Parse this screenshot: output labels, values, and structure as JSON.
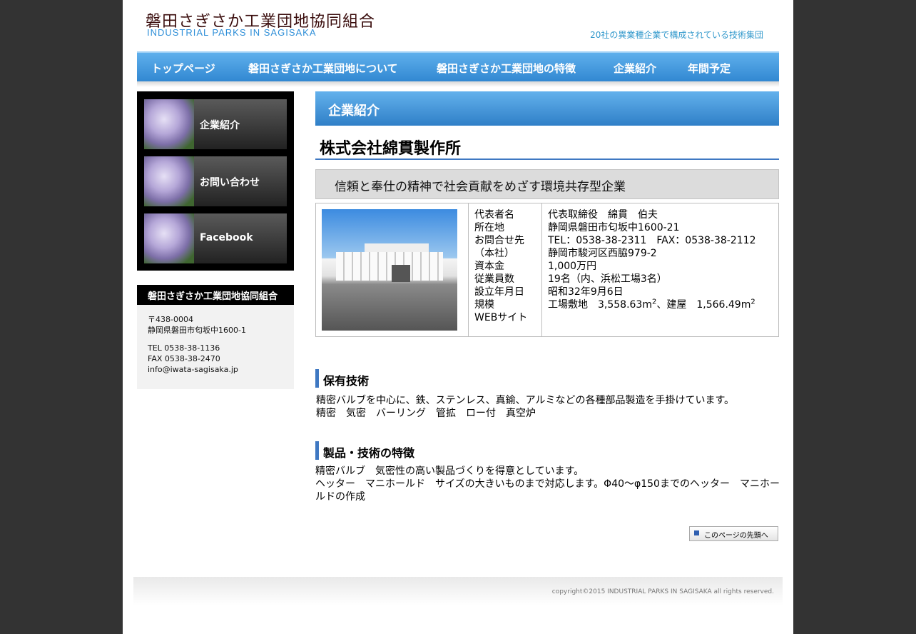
{
  "header": {
    "logo_jp": "磐田さぎさか工業団地協同組合",
    "logo_en": "INDUSTRIAL PARKS IN SAGISAKA",
    "tagline": "20社の異業種企業で構成されている技術集団"
  },
  "nav": {
    "items": [
      "トップページ",
      "磐田さぎさか工業団地について",
      "磐田さぎさか工業団地の特徴",
      "企業紹介",
      "年間予定"
    ]
  },
  "sidebar": {
    "buttons": [
      "企業紹介",
      "お問い合わせ",
      "Facebook"
    ],
    "org_title": "磐田さぎさか工業団地協同組合",
    "postal": "〒438-0004",
    "address": "静岡県磐田市匂坂中1600-1",
    "tel": "TEL 0538-38-1136",
    "fax": "FAX 0538-38-2470",
    "email": "info@iwata-sagisaka.jp"
  },
  "main": {
    "section_title": "企業紹介",
    "company_name": "株式会社綿貫製作所",
    "slogan": "信頼と奉仕の精神で社会貢献をめざす環境共存型企業",
    "info": {
      "labels": [
        "代表者名",
        "所在地",
        "お問合せ先",
        "（本社）",
        "資本金",
        "従業員数",
        "設立年月日",
        "規模",
        "WEBサイト"
      ],
      "representative": "代表取締役　綿貫　伯夫",
      "location": "静岡県磐田市匂坂中1600-21",
      "contact_tel_fax": "TEL：0538-38-2311　FAX：0538-38-2112",
      "hq": "静岡市駿河区西脇979-2",
      "capital": "1,000万円",
      "employees": "19名（内、浜松工場3名）",
      "founded": "昭和32年9月6日",
      "scale_site": "工場敷地　3,558.63m",
      "scale_sup1": "2",
      "scale_mid": "、建屋　1,566.49m",
      "scale_sup2": "2"
    },
    "tech_title": "保有技術",
    "tech_lines": [
      "精密バルブを中心に、鉄、ステンレス、真鍮、アルミなどの各種部品製造を手掛けています。",
      "精密　気密　バーリング　管拡　ロー付　真空炉"
    ],
    "features_title": "製品・技術の特徴",
    "features_lines": [
      "精密バルブ　気密性の高い製品づくりを得意としています。",
      "ヘッター　マニホールド　サイズの大きいものまで対応します。Φ40～φ150までのヘッター　マニホー",
      "ルドの作成"
    ],
    "back_to_top": "このページの先頭へ"
  },
  "footer": {
    "copyright": "copyright©2015 INDUSTRIAL PARKS IN SAGISAKA all rights reserved."
  }
}
